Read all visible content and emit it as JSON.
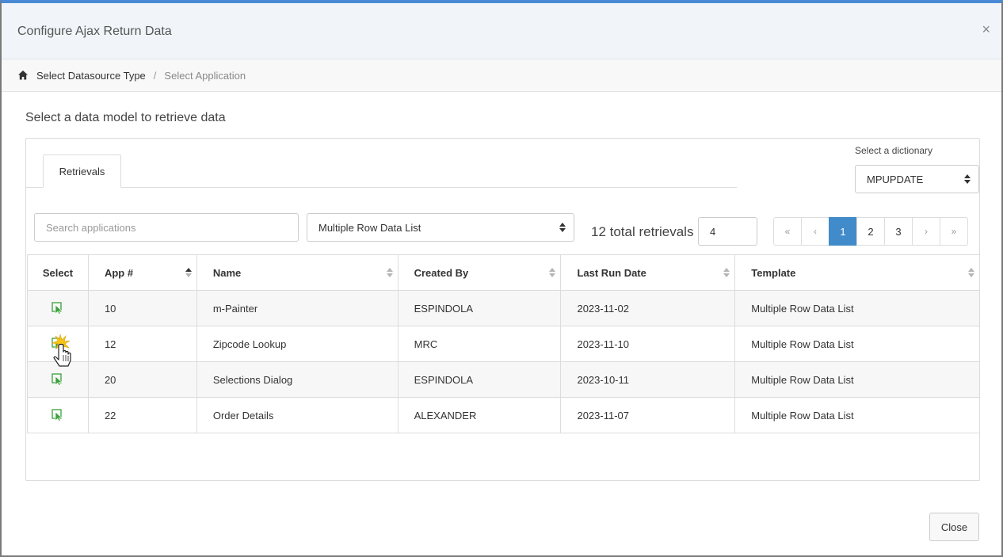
{
  "modal": {
    "title": "Configure Ajax Return Data",
    "close_glyph": "×"
  },
  "breadcrumb": {
    "items": [
      {
        "label": "Select Datasource Type",
        "icon": "home-icon"
      },
      {
        "label": "Select Application"
      }
    ],
    "separator": "/"
  },
  "section_title": "Select a data model to retrieve data",
  "tabs": [
    {
      "label": "Retrievals",
      "active": true
    }
  ],
  "dictionary": {
    "label": "Select a dictionary",
    "selected": "MPUPDATE"
  },
  "search": {
    "placeholder": "Search applications",
    "value": ""
  },
  "template_filter": {
    "selected": "Multiple Row Data List"
  },
  "total_text": "12 total retrievals",
  "per_page": "4",
  "pagination": {
    "first": "«",
    "prev": "‹",
    "pages": [
      "1",
      "2",
      "3"
    ],
    "current": "1",
    "next": "›",
    "last": "»"
  },
  "table": {
    "columns": [
      "Select",
      "App #",
      "Name",
      "Created By",
      "Last Run Date",
      "Template"
    ],
    "rows": [
      {
        "app": "10",
        "name": "m-Painter",
        "created_by": "ESPINDOLA",
        "last_run": "2023-11-02",
        "template": "Multiple Row Data List"
      },
      {
        "app": "12",
        "name": "Zipcode Lookup",
        "created_by": "MRC",
        "last_run": "2023-11-10",
        "template": "Multiple Row Data List"
      },
      {
        "app": "20",
        "name": "Selections Dialog",
        "created_by": "ESPINDOLA",
        "last_run": "2023-10-11",
        "template": "Multiple Row Data List"
      },
      {
        "app": "22",
        "name": "Order Details",
        "created_by": "ALEXANDER",
        "last_run": "2023-11-07",
        "template": "Multiple Row Data List"
      }
    ]
  },
  "footer": {
    "close_label": "Close"
  },
  "colors": {
    "accent": "#428bca",
    "select_icon": "#3aa03a",
    "header_bar": "#4a8ad4"
  }
}
